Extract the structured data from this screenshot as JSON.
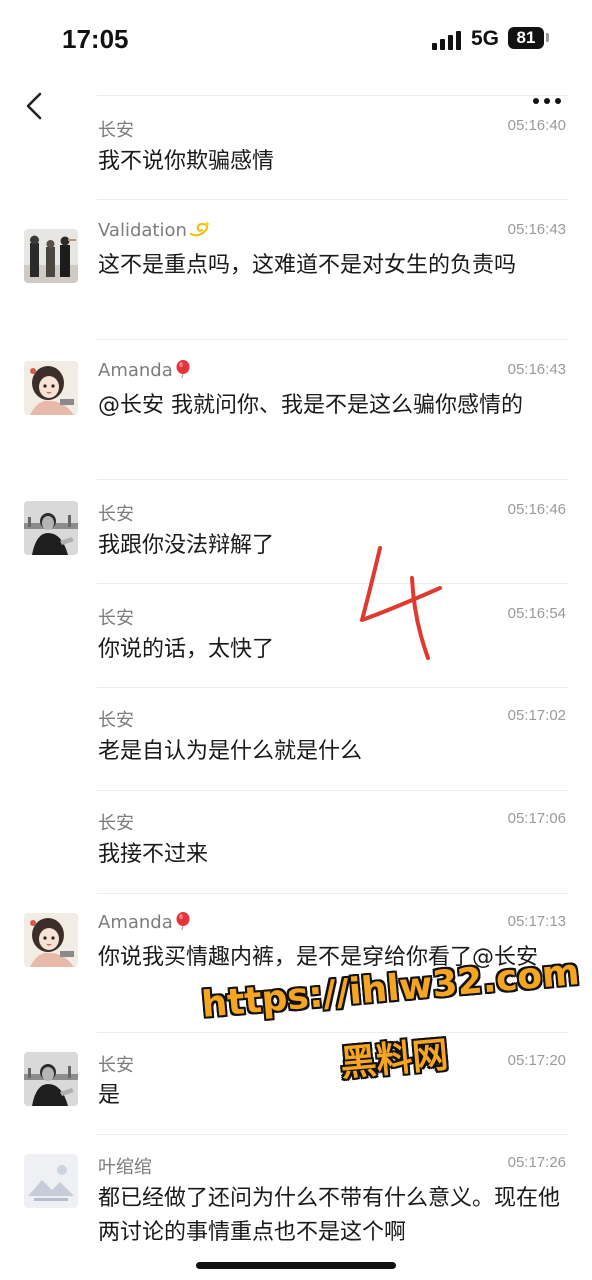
{
  "status_bar": {
    "time": "17:05",
    "network": "5G",
    "battery": "81"
  },
  "messages": [
    {
      "sender": "长安",
      "time": "05:16:40",
      "text": "我不说你欺骗感情",
      "avatar": "none"
    },
    {
      "sender": "Validation",
      "time": "05:16:43",
      "text": "这不是重点吗，这难道不是对女生的负责吗",
      "avatar": "figures-photo",
      "emoji": "dizzy"
    },
    {
      "sender": "Amanda",
      "time": "05:16:43",
      "text": "@长安 我就问你、我是不是这么骗你感情的",
      "avatar": "illustrated-girl",
      "emoji": "balloon"
    },
    {
      "sender": "长安",
      "time": "05:16:46",
      "text": "我跟你没法辩解了",
      "avatar": "man-photo"
    },
    {
      "sender": "长安",
      "time": "05:16:54",
      "text": "你说的话，太快了",
      "avatar": "none"
    },
    {
      "sender": "长安",
      "time": "05:17:02",
      "text": "老是自认为是什么就是什么",
      "avatar": "none"
    },
    {
      "sender": "长安",
      "time": "05:17:06",
      "text": "我接不过来",
      "avatar": "none"
    },
    {
      "sender": "Amanda",
      "time": "05:17:13",
      "text": "你说我买情趣内裤，是不是穿给你看了@长安",
      "avatar": "illustrated-girl",
      "emoji": "balloon"
    },
    {
      "sender": "长安",
      "time": "05:17:20",
      "text": "是",
      "avatar": "man-photo"
    },
    {
      "sender": "叶绾绾",
      "time": "05:17:26",
      "text": "都已经做了还问为什么不带有什么意义。现在他两讨论的事情重点也不是这个啊",
      "avatar": "placeholder-image"
    }
  ],
  "annotation": {
    "mark": "4",
    "color": "#e03a2e"
  },
  "watermark": {
    "url": "https://ihlw32.com",
    "brand": "黑料网",
    "color": "#f6a520"
  }
}
